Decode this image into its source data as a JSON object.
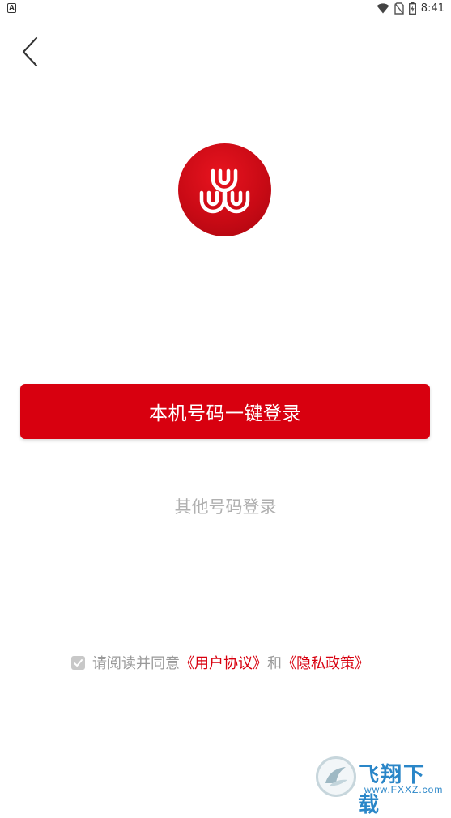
{
  "status_bar": {
    "notification_icon": "A",
    "time": "8:41",
    "icons": [
      "wifi-icon",
      "no-sim-icon",
      "battery-charging-icon"
    ]
  },
  "header": {
    "back_icon": "chevron-left-icon"
  },
  "logo": {
    "icon": "app-logo",
    "color": "#d10a14"
  },
  "login": {
    "primary_label": "本机号码一键登录",
    "other_label": "其他号码登录"
  },
  "agreement": {
    "checked": true,
    "prefix": "请阅读并同意",
    "user_agreement": "《用户协议》",
    "and": "和",
    "privacy_policy": "《隐私政策》"
  },
  "watermark": {
    "title": "飞翔下载",
    "url": "www.FXXZ.com"
  },
  "colors": {
    "accent": "#d8000f",
    "muted_text": "#b0b0b0",
    "checkbox": "#c8c8c8"
  }
}
